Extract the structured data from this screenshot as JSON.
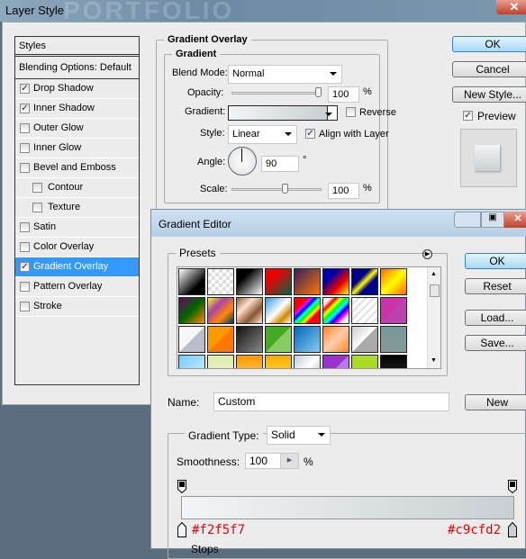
{
  "layer_style": {
    "title": "Layer Style",
    "watermark": "PORTFOLIO",
    "styles_header": "Styles",
    "blending": "Blending Options: Default",
    "items": [
      {
        "label": "Drop Shadow",
        "checked": true
      },
      {
        "label": "Inner Shadow",
        "checked": true
      },
      {
        "label": "Outer Glow",
        "checked": false
      },
      {
        "label": "Inner Glow",
        "checked": false
      },
      {
        "label": "Bevel and Emboss",
        "checked": false
      },
      {
        "label": "Contour",
        "checked": false,
        "sub": true
      },
      {
        "label": "Texture",
        "checked": false,
        "sub": true
      },
      {
        "label": "Satin",
        "checked": false
      },
      {
        "label": "Color Overlay",
        "checked": false
      },
      {
        "label": "Gradient Overlay",
        "checked": true,
        "selected": true
      },
      {
        "label": "Pattern Overlay",
        "checked": false
      },
      {
        "label": "Stroke",
        "checked": false
      }
    ],
    "section": "Gradient Overlay",
    "group": "Gradient",
    "blend_mode_label": "Blend Mode:",
    "blend_mode": "Normal",
    "opacity_label": "Opacity:",
    "opacity": "100",
    "pct": "%",
    "gradient_label": "Gradient:",
    "reverse": "Reverse",
    "style_label": "Style:",
    "style": "Linear",
    "align": "Align with Layer",
    "angle_label": "Angle:",
    "angle": "90",
    "deg": "°",
    "scale_label": "Scale:",
    "scale": "100",
    "ok": "OK",
    "cancel": "Cancel",
    "new_style": "New Style...",
    "preview": "Preview"
  },
  "gradient_editor": {
    "title": "Gradient Editor",
    "presets": "Presets",
    "ok": "OK",
    "reset": "Reset",
    "load": "Load...",
    "save": "Save...",
    "new": "New",
    "name_label": "Name:",
    "name": "Custom",
    "type_label": "Gradient Type:",
    "type": "Solid",
    "smooth_label": "Smoothness:",
    "smoothness": "100",
    "pct": "%",
    "color_start": "#f2f5f7",
    "color_end": "#c9cfd2",
    "stops_label": "Stops"
  },
  "colors": {
    "selection": "#3399ff",
    "hex_text": "#ee0000"
  }
}
